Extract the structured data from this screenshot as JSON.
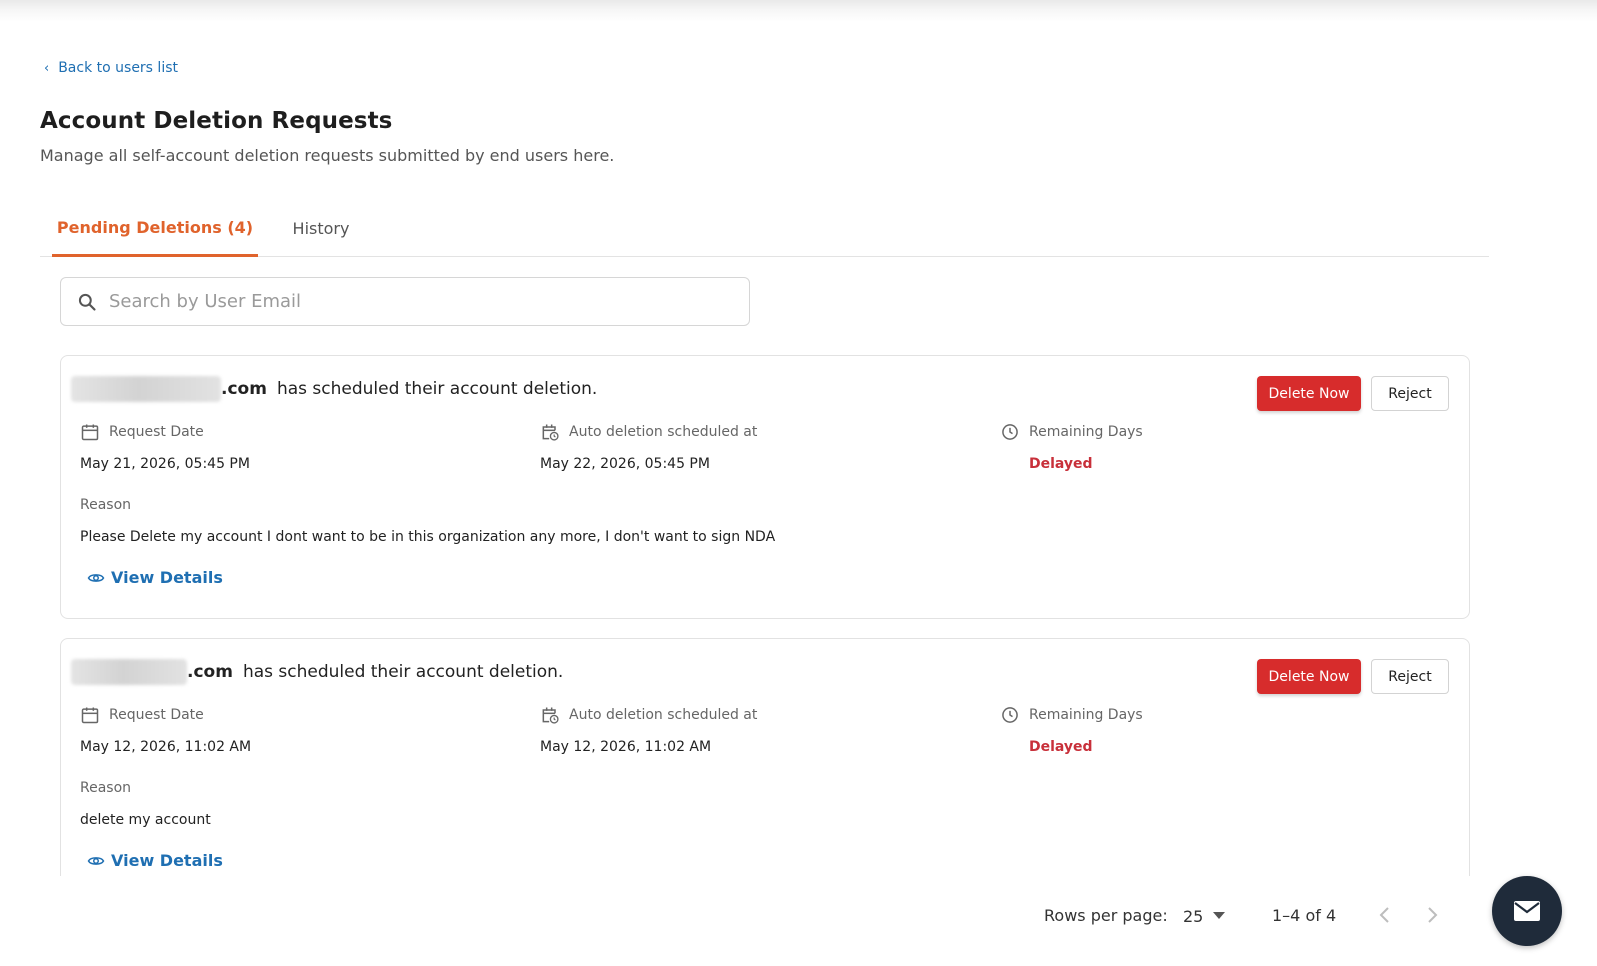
{
  "nav": {
    "back_label": "Back to users list"
  },
  "header": {
    "title": "Account Deletion Requests",
    "subtitle": "Manage all self-account deletion requests submitted by end users here."
  },
  "tabs": [
    {
      "label": "Pending Deletions (4)",
      "active": true
    },
    {
      "label": "History",
      "active": false
    }
  ],
  "search": {
    "placeholder": "Search by User Email",
    "value": ""
  },
  "labels": {
    "request_date": "Request Date",
    "auto_deletion": "Auto deletion scheduled at",
    "remaining_days": "Remaining Days",
    "reason": "Reason",
    "view_details": "View Details",
    "delete_now": "Delete Now",
    "reject": "Reject",
    "scheduled_suffix": "has scheduled their account deletion."
  },
  "requests": [
    {
      "email_domain": ".com",
      "request_date": "May 21, 2026, 05:45 PM",
      "auto_deletion_at": "May 22, 2026, 05:45 PM",
      "remaining_days": "Delayed",
      "reason": "Please Delete my account I dont want to be in this organization any more, I don't want to sign NDA"
    },
    {
      "email_domain": ".com",
      "request_date": "May 12, 2026, 11:02 AM",
      "auto_deletion_at": "May 12, 2026, 11:02 AM",
      "remaining_days": "Delayed",
      "reason": "delete my account"
    }
  ],
  "pagination": {
    "rows_per_page_label": "Rows per page:",
    "rows_per_page": "25",
    "range": "1–4 of 4"
  },
  "icons": {
    "back": "chevron-left-icon",
    "search": "search-icon",
    "request_date": "calendar-icon",
    "auto_deletion": "calendar-clock-icon",
    "remaining_days": "clock-icon",
    "view_details": "eye-icon",
    "rows_dropdown": "caret-down-icon",
    "prev": "chevron-left-icon",
    "next": "chevron-right-icon",
    "chat": "mail-icon"
  },
  "colors": {
    "accent_tab": "#e0632c",
    "link": "#1f6fb2",
    "danger": "#d72c2c",
    "delayed": "#c8303a",
    "fab": "#1f2b3a"
  }
}
